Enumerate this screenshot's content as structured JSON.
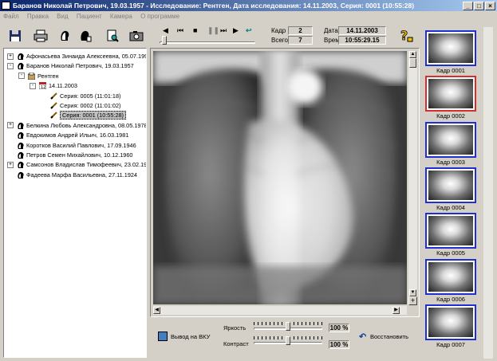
{
  "window": {
    "title": "Баранов Николай Петрович, 19.03.1957  -  Исследование: Рентген,  Дата исследования: 14.11.2003,  Серия: 0001 (10:55:28)"
  },
  "menu": [
    "Файл",
    "Правка",
    "Вид",
    "Пациент",
    "Камера",
    "О программе"
  ],
  "frame": {
    "kadr_label": "Кадр",
    "kadr_value": "2",
    "vsego_label": "Всего",
    "vsego_value": "7"
  },
  "datetime": {
    "date_label": "Дата",
    "date_value": "14.11.2003",
    "time_label": "Время",
    "time_value": "10:55:29.15"
  },
  "playback": {
    "position": 0.03
  },
  "tree": [
    {
      "label": "Афонасьева Зинаида Алексеевна, 05.07.1990",
      "level": 0,
      "expander": "+",
      "icon": "patient-icon"
    },
    {
      "label": "Баранов Николай Петрович, 19.03.1957",
      "level": 0,
      "expander": "-",
      "icon": "patient-icon"
    },
    {
      "label": "Рентген",
      "level": 1,
      "expander": "-",
      "icon": "study-icon"
    },
    {
      "label": "14.11.2003",
      "level": 2,
      "expander": "-",
      "icon": "date-icon"
    },
    {
      "label": "Серия:  0005  (11:01:18)",
      "level": 3,
      "expander": "",
      "icon": "series-icon"
    },
    {
      "label": "Серия:  0002  (11:01:02)",
      "level": 3,
      "expander": "",
      "icon": "series-icon"
    },
    {
      "label": "Серия:  0001  (10:55:28)",
      "level": 3,
      "expander": "",
      "icon": "series-icon",
      "selected": true
    },
    {
      "label": "Белкина Любовь Александровна, 08.05.1978",
      "level": 0,
      "expander": "+",
      "icon": "patient-icon"
    },
    {
      "label": "Евдокимов Андрей Ильич, 16.03.1981",
      "level": 0,
      "expander": "",
      "icon": "patient-icon"
    },
    {
      "label": "Коротков Василий Павлович, 17.09.1946",
      "level": 0,
      "expander": "",
      "icon": "patient-icon"
    },
    {
      "label": "Петров Семен Михайлович, 10.12.1960",
      "level": 0,
      "expander": "",
      "icon": "patient-icon"
    },
    {
      "label": "Самсонов Владислав Тимофеевич, 23.02.196",
      "level": 0,
      "expander": "+",
      "icon": "patient-icon"
    },
    {
      "label": "Фадеева Марфа Васильевна, 27.11.1924",
      "level": 0,
      "expander": "",
      "icon": "patient-icon"
    }
  ],
  "thumbnails": [
    {
      "label": "Кадр  0001",
      "selected": false
    },
    {
      "label": "Кадр  0002",
      "selected": true
    },
    {
      "label": "Кадр  0003",
      "selected": false
    },
    {
      "label": "Кадр  0004",
      "selected": false
    },
    {
      "label": "Кадр  0005",
      "selected": false
    },
    {
      "label": "Кадр  0006",
      "selected": false
    },
    {
      "label": "Кадр  0007",
      "selected": false
    }
  ],
  "bottom": {
    "vku_label": "Вывод на ВКУ",
    "brightness_label": "Яркость",
    "brightness_value": "100 %",
    "brightness_level": 0.5,
    "contrast_label": "Контраст",
    "contrast_value": "100 %",
    "contrast_level": 0.5,
    "restore_label": "Восстановить"
  },
  "colors": {
    "title_start": "#0a246a",
    "title_end": "#a6caf0",
    "thumb_border": "#2030d0",
    "thumb_selected_border": "#d03030",
    "selection": "#c0c0c0"
  }
}
